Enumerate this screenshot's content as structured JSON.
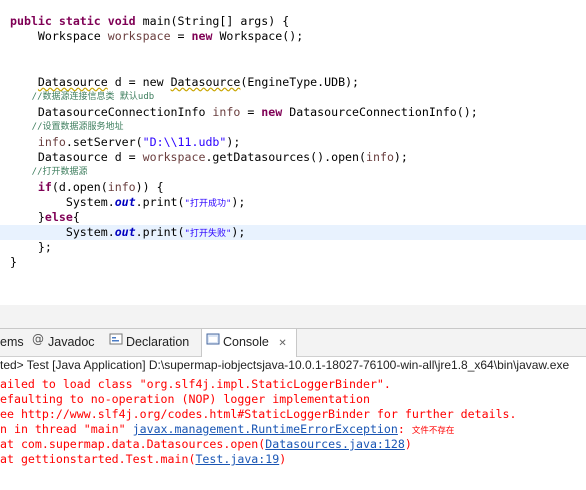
{
  "code": {
    "l1_kw": "public static void",
    "l1_rest": " main(String[] args) {",
    "l2_a": "    Workspace ",
    "l2_var": "workspace",
    "l2_b": " = ",
    "l2_kw": "new",
    "l2_c": " Workspace();",
    "l5_a": "    ",
    "l5_type": "Datasource",
    "l5_b": " d = new ",
    "l5_type2": "Datasource",
    "l5_c": "(EngineType.UDB);",
    "l6_comment": "    //数据源连接信息类 默认udb",
    "l7_a": "    DatasourceConnectionInfo ",
    "l7_var": "info",
    "l7_b": " = ",
    "l7_kw": "new",
    "l7_c": " DatasourceConnectionInfo();",
    "l8_comment": "    //设置数据源服务地址",
    "l9_a": "    ",
    "l9_var": "info",
    "l9_b": ".setServer(",
    "l9_str": "\"D:\\\\11.udb\"",
    "l9_c": ");",
    "l10_a": "    Datasource d = ",
    "l10_var": "workspace",
    "l10_b": ".getDatasources().open(",
    "l10_var2": "info",
    "l10_c": ");",
    "l11_comment": "    //打开数据源",
    "l12_a": "    ",
    "l12_kw": "if",
    "l12_b": "(d.open(",
    "l12_var": "info",
    "l12_c": ")) {",
    "l13_a": "        System.",
    "l13_fld": "out",
    "l13_b": ".print(",
    "l13_str": "\"打开成功\"",
    "l13_c": ");",
    "l14_a": "    }",
    "l14_kw": "else",
    "l14_b": "{",
    "l15_a": "        System.",
    "l15_fld": "out",
    "l15_b": ".print(",
    "l15_str": "\"打开失败\"",
    "l15_c": ");",
    "l16": "    };",
    "l17": "}"
  },
  "tabs": {
    "problems": "ems",
    "javadoc": "Javadoc",
    "declaration": "Declaration",
    "console": "Console",
    "console_close": "✕"
  },
  "console": {
    "description": "ted> Test [Java Application] D:\\supermap-iobjectsjava-10.0.1-18027-76100-win-all\\jre1.8_x64\\bin\\javaw.exe",
    "line1": "ailed to load class \"org.slf4j.impl.StaticLoggerBinder\".",
    "line2": "efaulting to no-operation (NOP) logger implementation",
    "line3": "ee http://www.slf4j.org/codes.html#StaticLoggerBinder for further details.",
    "line4_a": "n in thread \"main\" ",
    "line4_link": "javax.management.RuntimeErrorException",
    "line4_b": ": ",
    "line4_cn": "文件不存在",
    "line5_a": "at com.supermap.data.Datasources.open(",
    "line5_link": "Datasources.java:128",
    "line5_b": ")",
    "line6_a": "at gettionstarted.Test.main(",
    "line6_link": "Test.java:19",
    "line6_b": ")"
  },
  "colors": {
    "keyword": "#7f0055",
    "string": "#2a00ff",
    "comment": "#3f7f5f",
    "error": "#ff0000",
    "link": "#1a56b4",
    "current_line": "#e8f2fe"
  }
}
